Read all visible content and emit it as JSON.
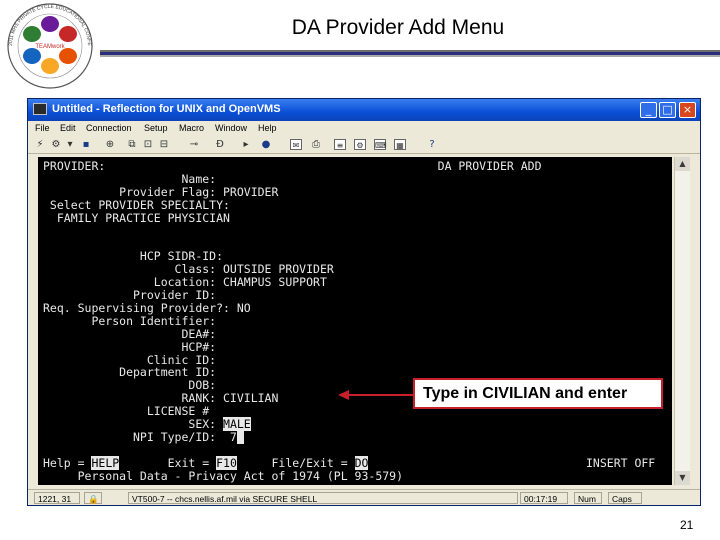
{
  "slide": {
    "title": "DA Provider Add Menu",
    "page_number": "21",
    "logo": {
      "name": "conference-logo",
      "ring_text": "2011 MHS PRIVATE CYCLE EDUCATIONAL CONFERENCE",
      "center_text": "TEAMwork",
      "hand_colors": [
        "#2e7d32",
        "#c62828",
        "#e65100",
        "#1565c0",
        "#6a1b9a",
        "#f9a825"
      ]
    }
  },
  "window": {
    "title": "Untitled - Reflection for UNIX and OpenVMS",
    "menu": [
      "File",
      "Edit",
      "Connection",
      "Setup",
      "Macro",
      "Window",
      "Help"
    ],
    "controls": {
      "minimize": "_",
      "maximize": "□",
      "close": "×"
    }
  },
  "terminal": {
    "lines": [
      {
        "text": "PROVIDER:                                                DA PROVIDER ADD"
      },
      {
        "text": "                    Name:"
      },
      {
        "text": "           Provider Flag: PROVIDER"
      },
      {
        "text": " Select PROVIDER SPECIALTY:"
      },
      {
        "text": "  FAMILY PRACTICE PHYSICIAN"
      },
      {
        "text": ""
      },
      {
        "text": ""
      },
      {
        "text": "              HCP SIDR-ID:"
      },
      {
        "text": "                   Class: OUTSIDE PROVIDER"
      },
      {
        "text": "                Location: CHAMPUS SUPPORT"
      },
      {
        "text": "             Provider ID:"
      },
      {
        "text": "Req. Supervising Provider?: NO"
      },
      {
        "text": "       Person Identifier:"
      },
      {
        "text": "                    DEA#:"
      },
      {
        "text": "                    HCP#:"
      },
      {
        "text": "               Clinic ID:"
      },
      {
        "text": "           Department ID:"
      },
      {
        "text": "                     DOB:"
      },
      {
        "text": "                    RANK: CIVILIAN"
      },
      {
        "text": "               LICENSE #"
      },
      {
        "pre": "                     SEX: ",
        "hl": "MALE",
        "post": ""
      },
      {
        "pre": "             NPI Type/ID:  7",
        "hl": "",
        "post": ""
      },
      {
        "text": ""
      },
      {
        "pre": "Help = ",
        "hl": "HELP",
        "post": "       Exit = "
      },
      {
        "text": "     Personal Data - Privacy Act of 1974 (PL 93-579)"
      }
    ],
    "footer": {
      "exit_key": "F10",
      "file_exit_label": "     File/Exit = ",
      "file_exit_key": "DO",
      "mode": "INSERT OFF"
    }
  },
  "status_bar": {
    "position": "1221, 31",
    "session": "VT500-7 -- chcs.nellis.af.mil via SECURE SHELL",
    "time": "00:17:19",
    "num": "Num",
    "caps": "Caps"
  },
  "callout": {
    "text": "Type in CIVILIAN and enter",
    "color": "#c8202a"
  }
}
